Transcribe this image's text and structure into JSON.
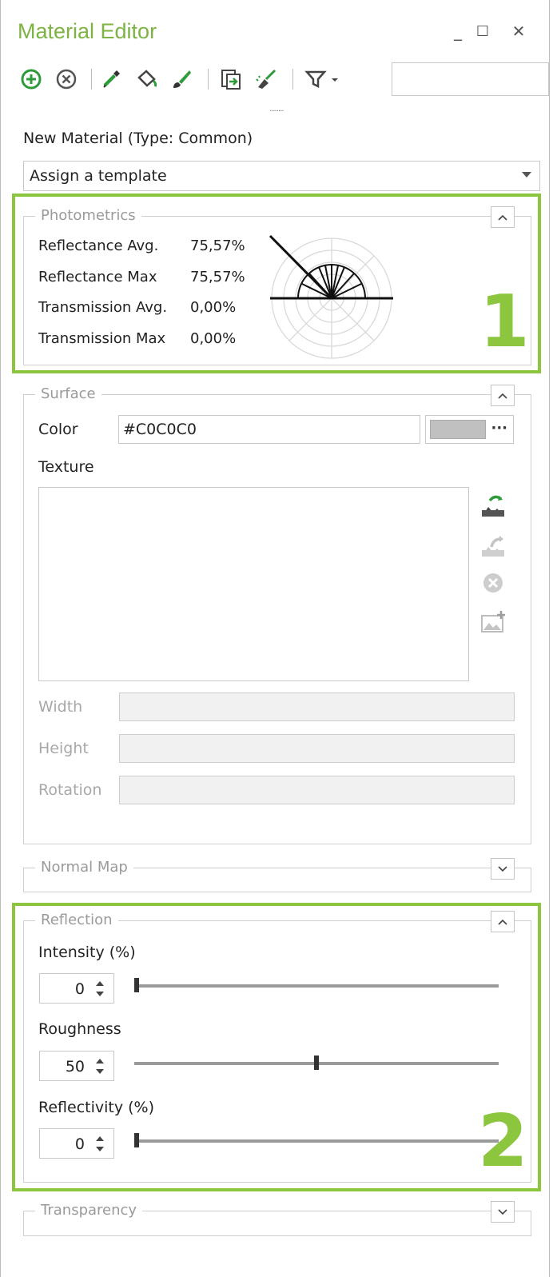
{
  "window": {
    "title": "Material Editor",
    "minimize_glyph": "_",
    "maximize_glyph": "☐",
    "close_glyph": "✕"
  },
  "toolbar": {
    "icons": [
      "add-icon",
      "remove-icon",
      "eyedropper-icon",
      "paint-bucket-icon",
      "brush-icon",
      "import-icon",
      "clean-icon",
      "filter-icon"
    ],
    "accent_color": "#7cb342",
    "search_value": ""
  },
  "material": {
    "name": "New Material (Type: Common)",
    "template_placeholder": "Assign a template"
  },
  "photometrics": {
    "label": "Photometrics",
    "rows": [
      {
        "label": "Reflectance Avg.",
        "value": "75,57%"
      },
      {
        "label": "Reflectance Max",
        "value": "75,57%"
      },
      {
        "label": "Transmission Avg.",
        "value": "0,00%"
      },
      {
        "label": "Transmission Max",
        "value": "0,00%"
      }
    ],
    "callout": "1"
  },
  "surface": {
    "label": "Surface",
    "color_label": "Color",
    "color_value": "#C0C0C0",
    "swatch_color": "#c0c0c0",
    "more_glyph": "···",
    "texture_label": "Texture",
    "width_label": "Width",
    "height_label": "Height",
    "rotation_label": "Rotation",
    "texture_icons": [
      "load-texture-icon",
      "export-texture-icon",
      "clear-texture-icon",
      "add-image-icon"
    ]
  },
  "normal_map": {
    "label": "Normal Map"
  },
  "reflection": {
    "label": "Reflection",
    "intensity_label": "Intensity (%)",
    "intensity_value": "0",
    "intensity_level": 0,
    "roughness_label": "Roughness",
    "roughness_value": "50",
    "roughness_level": 50,
    "reflectivity_label": "Reflectivity (%)",
    "reflectivity_value": "0",
    "reflectivity_level": 0,
    "callout": "2"
  },
  "transparency": {
    "label": "Transparency"
  },
  "highlight_color": "#8cc63f"
}
